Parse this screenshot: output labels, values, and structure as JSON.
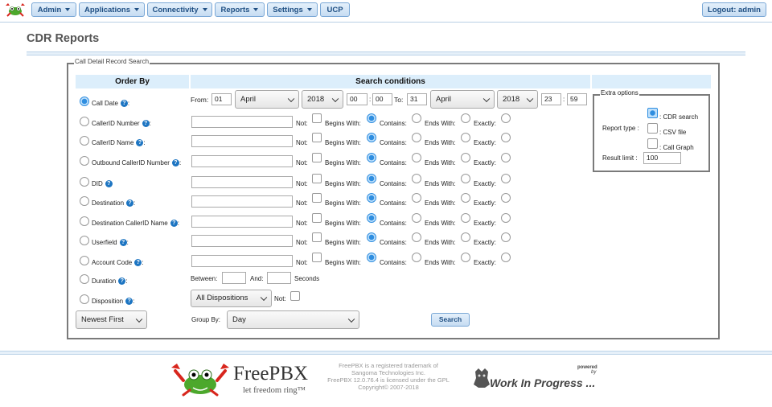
{
  "nav": {
    "items": [
      {
        "label": "Admin"
      },
      {
        "label": "Applications"
      },
      {
        "label": "Connectivity"
      },
      {
        "label": "Reports"
      },
      {
        "label": "Settings"
      },
      {
        "label": "UCP"
      }
    ],
    "logout": "Logout: admin"
  },
  "page": {
    "title": "CDR Reports",
    "legend": "Call Detail Record Search"
  },
  "headers": {
    "order_by": "Order By",
    "search_conditions": "Search conditions"
  },
  "order_fields": [
    {
      "label": "Call Date",
      "help": "?",
      "suffix": ":",
      "selected": true
    },
    {
      "label": "CallerID Number",
      "help": "?",
      "suffix": ":",
      "selected": false
    },
    {
      "label": "CallerID Name",
      "help": "?",
      "suffix": ":",
      "selected": false
    },
    {
      "label": "Outbound CallerID Number",
      "help": "?",
      "suffix": ":",
      "selected": false
    },
    {
      "label": "DID",
      "help": "?",
      "suffix": "",
      "selected": false
    },
    {
      "label": "Destination",
      "help": "?",
      "suffix": ":",
      "selected": false
    },
    {
      "label": "Destination CallerID Name",
      "help": "?",
      "suffix": ":",
      "selected": false
    },
    {
      "label": "Userfield",
      "help": "?",
      "suffix": ":",
      "selected": false
    },
    {
      "label": "Account Code",
      "help": "?",
      "suffix": ":",
      "selected": false
    },
    {
      "label": "Duration",
      "help": "?",
      "suffix": ":",
      "selected": false
    },
    {
      "label": "Disposition",
      "help": "?",
      "suffix": ":",
      "selected": false
    }
  ],
  "date_range": {
    "from_label": "From:",
    "from_day": "01",
    "from_month": "April",
    "from_year": "2018",
    "from_hour": "00",
    "from_minute": "00",
    "to_label": "To:",
    "to_day": "31",
    "to_month": "April",
    "to_year": "2018",
    "to_hour": "23",
    "to_minute": "59",
    "colon": ":"
  },
  "match_labels": {
    "not": "Not:",
    "begins": "Begins With:",
    "contains": "Contains:",
    "ends": "Ends With:",
    "exactly": "Exactly:"
  },
  "duration": {
    "between": "Between:",
    "and": "And:",
    "seconds": "Seconds",
    "min": "",
    "max": ""
  },
  "disposition": {
    "value": "All Dispositions",
    "not": "Not:"
  },
  "sort_order": "Newest First",
  "group_by": {
    "label": "Group By:",
    "value": "Day"
  },
  "search_button": "Search",
  "extra": {
    "legend": "Extra options",
    "report_type_label": "Report type :",
    "cdr_search": ": CDR search",
    "csv_file": ": CSV file",
    "call_graph": ": Call Graph",
    "result_limit_label": "Result limit :",
    "result_limit": "100"
  },
  "footer": {
    "brand": "FreePBX",
    "tagline": "let freedom ring™",
    "legal_line1": "FreePBX is a registered trademark of",
    "legal_line2": "Sangoma Technologies Inc.",
    "legal_line3": "FreePBX 12.0.76.4 is licensed under the GPL",
    "legal_line4": "Copyright© 2007-2018",
    "powered": "powered",
    "by": "by",
    "wip": "Work In Progress ..."
  },
  "colors": {
    "accent": "#1f4f83",
    "header_bg": "#dceefb",
    "radio_on": "#2f8ee0",
    "frog_green": "#4ca82c",
    "frog_red": "#d8261d"
  }
}
